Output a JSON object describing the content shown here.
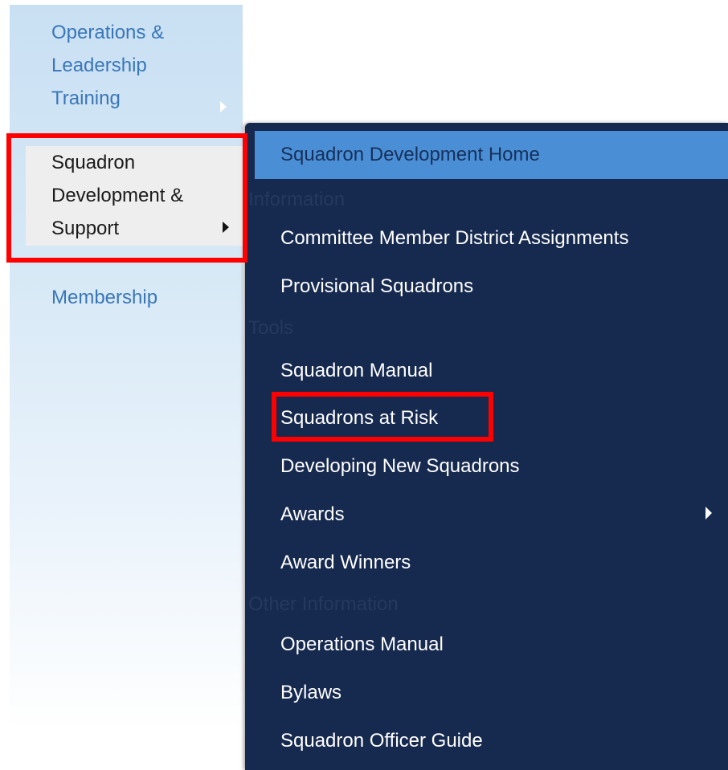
{
  "sidebar": {
    "items": [
      {
        "label_lines": [
          "Operations &",
          "Leadership",
          "Training"
        ]
      },
      {
        "label_lines": [
          "Squadron",
          "Development &",
          "Support"
        ]
      },
      {
        "label_lines": [
          "Membership"
        ]
      }
    ]
  },
  "flyout": {
    "home": "Squadron Development Home",
    "sections": {
      "information": "Information",
      "tools": "Tools",
      "other": "Other Information"
    },
    "items": {
      "committee": "Committee Member District Assignments",
      "provisional": "Provisional Squadrons",
      "manual": "Squadron Manual",
      "at_risk": "Squadrons at Risk",
      "developing": "Developing New Squadrons",
      "awards": "Awards",
      "award_winners": "Award Winners",
      "ops_manual": "Operations Manual",
      "bylaws": "Bylaws",
      "officer_guide": "Squadron Officer Guide"
    }
  },
  "colors": {
    "flyout_bg": "#16294f",
    "home_bg": "#4a8fd6",
    "sidebar_link": "#3a76b8",
    "highlight": "#ff0000"
  }
}
